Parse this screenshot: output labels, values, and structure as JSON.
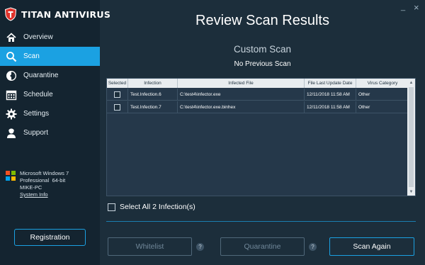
{
  "app": {
    "name": "TITAN ANTIVIRUS"
  },
  "window_controls": {
    "minimize": "_",
    "close": "×"
  },
  "sidebar": {
    "items": [
      {
        "label": "Overview",
        "icon": "home-icon"
      },
      {
        "label": "Scan",
        "icon": "search-icon",
        "active": true
      },
      {
        "label": "Quarantine",
        "icon": "radiation-icon"
      },
      {
        "label": "Schedule",
        "icon": "calendar-icon"
      },
      {
        "label": "Settings",
        "icon": "gear-icon"
      },
      {
        "label": "Support",
        "icon": "support-person-icon"
      }
    ],
    "system": {
      "os": "Microsoft Windows 7",
      "edition": "Professional  64-bit",
      "machine": "MIKE-PC",
      "link": "System Info"
    },
    "registration_label": "Registration"
  },
  "main": {
    "title": "Review Scan Results",
    "scan_type": "Custom Scan",
    "previous_scan": "No Previous Scan"
  },
  "table": {
    "headers": [
      "Selected",
      "Infection",
      "Infected File",
      "File Last Update Date",
      "Virus Category"
    ],
    "rows": [
      {
        "infection": "Test.Infection.6",
        "file": "C:\\test4\\infector.exe",
        "date": "12/11/2018 11:58 AM",
        "category": "Other"
      },
      {
        "infection": "Test.Infection.7",
        "file": "C:\\test4\\infector.exe.binhex",
        "date": "12/11/2018 11:58 AM",
        "category": "Other"
      }
    ]
  },
  "select_all_label": "Select All 2 Infection(s)",
  "buttons": {
    "whitelist": "Whitelist",
    "quarantine": "Quarantine",
    "scan_again": "Scan Again",
    "help": "?"
  },
  "colors": {
    "accent": "#1ba1e2",
    "sidebar_bg": "#142430",
    "main_bg": "#1c2e3b",
    "logo_red": "#e0322b"
  }
}
